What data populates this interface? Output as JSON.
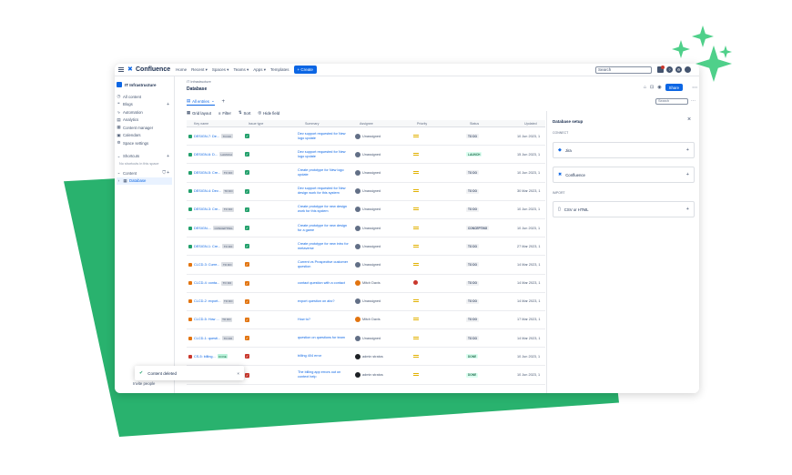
{
  "header": {
    "app_name": "Confluence",
    "nav": [
      "Home",
      "Recent ▾",
      "Spaces ▾",
      "Teams ▾",
      "Apps ▾",
      "Templates"
    ],
    "create_label": "+ Create",
    "search_placeholder": "Search"
  },
  "sidebar": {
    "space_name": "IT Infrastructure",
    "items": [
      {
        "icon": "clock-icon",
        "label": "All content"
      },
      {
        "icon": "blog-icon",
        "label": "Blogs"
      },
      {
        "icon": "bolt-icon",
        "label": "Automation"
      },
      {
        "icon": "chart-icon",
        "label": "Analytics"
      },
      {
        "icon": "content-icon",
        "label": "Content manager"
      },
      {
        "icon": "calendar-icon",
        "label": "Calendars"
      },
      {
        "icon": "gear-icon",
        "label": "Space settings"
      }
    ],
    "shortcuts_label": "Shortcuts",
    "shortcuts_note": "No shortcuts in this space",
    "content_label": "Content",
    "tree_item": "Database",
    "bottom_label": "Invite people"
  },
  "toast": {
    "message": "Content deleted"
  },
  "page": {
    "breadcrumb": "IT Infrastructure",
    "title": "Database",
    "share_label": "Share",
    "view_tab": "All entries",
    "search_placeholder": "Search",
    "toolbar": [
      "Grid layout",
      "Filter",
      "Sort",
      "Hide field"
    ]
  },
  "table": {
    "columns": [
      "Key name",
      "Issue type",
      "Summary",
      "Assignee",
      "Priority",
      "Status",
      "Updated"
    ],
    "rows": [
      {
        "key": "DESIGN-7: De...",
        "tag": "TO DO",
        "type": "green",
        "summary": "Dev support requested for New logo update",
        "assignee": "Unassigned",
        "avatar": "none",
        "priority": "medium",
        "status": "TO DO",
        "date": "10 Jun 2023, 1"
      },
      {
        "key": "DESIGN-6: D...",
        "tag": "LAUNCH",
        "type": "green",
        "summary": "Dev support requested for New logo update",
        "assignee": "Unassigned",
        "avatar": "none",
        "priority": "medium",
        "status": "LAUNCH",
        "date": "15 Jun 2023, 1"
      },
      {
        "key": "DESIGN-5: Cre...",
        "tag": "TO DO",
        "type": "green",
        "summary": "Create prototype for New logo update",
        "assignee": "Unassigned",
        "avatar": "none",
        "priority": "medium",
        "status": "TO DO",
        "date": "10 Jun 2023, 1"
      },
      {
        "key": "DESIGN-4: Dev...",
        "tag": "TO DO",
        "type": "green",
        "summary": "Dev support requested for New design work for this system",
        "assignee": "Unassigned",
        "avatar": "none",
        "priority": "medium",
        "status": "TO DO",
        "date": "30 Mar 2023, 1"
      },
      {
        "key": "DESIGN-3: Cre...",
        "tag": "TO DO",
        "type": "green",
        "summary": "Create prototype for new design work for this system",
        "assignee": "Unassigned",
        "avatar": "none",
        "priority": "medium",
        "status": "TO DO",
        "date": "10 Jun 2023, 1"
      },
      {
        "key": "DESIGN-...",
        "tag": "CONCEPTING",
        "type": "green",
        "summary": "Create prototype for new design for a game",
        "assignee": "Unassigned",
        "avatar": "none",
        "priority": "medium",
        "status": "CONCEPTING",
        "date": "10 Jun 2023, 1"
      },
      {
        "key": "DESIGN-1: Cre...",
        "tag": "TO DO",
        "type": "green",
        "summary": "Create prototype for new intro for metaverse",
        "assignee": "Unassigned",
        "avatar": "none",
        "priority": "medium",
        "status": "TO DO",
        "date": "27 Mar 2023, 1"
      },
      {
        "key": "CLCD-3: Curre...",
        "tag": "TO DO",
        "type": "orange",
        "summary": "Current vs Prospective customer question",
        "assignee": "Unassigned",
        "avatar": "none",
        "priority": "medium",
        "status": "TO DO",
        "date": "14 Mar 2023, 1"
      },
      {
        "key": "CLCD-4: conta...",
        "tag": "TO DO",
        "type": "orange",
        "summary": "contact question with a contact",
        "assignee": "Mitch Davis",
        "avatar": "mitch",
        "priority": "high",
        "status": "TO DO",
        "date": "14 Mar 2023, 1"
      },
      {
        "key": "CLCD-2: export...",
        "tag": "TO DO",
        "type": "orange",
        "summary": "export question on abc?",
        "assignee": "Unassigned",
        "avatar": "none",
        "priority": "medium",
        "status": "TO DO",
        "date": "14 Mar 2023, 1"
      },
      {
        "key": "CLCD-5: How ...",
        "tag": "TO DO",
        "type": "orange",
        "summary": "How to?",
        "assignee": "Mitch Davis",
        "avatar": "mitch",
        "priority": "medium",
        "status": "TO DO",
        "date": "17 Mar 2023, 1"
      },
      {
        "key": "CLCD-1: questi...",
        "tag": "TO DO",
        "type": "orange",
        "summary": "question on questions for team",
        "assignee": "Unassigned",
        "avatar": "none",
        "priority": "medium",
        "status": "TO DO",
        "date": "14 Mar 2023, 1"
      },
      {
        "key": "CS-5: billing...",
        "tag": "DONE",
        "type": "red",
        "summary": "billing 404 error",
        "assignee": "admin stratos",
        "avatar": "admin",
        "priority": "medium",
        "status": "DONE",
        "date": "10 Jun 2023, 1"
      },
      {
        "key": "CS-4: The billin...",
        "tag": "DONE",
        "type": "red",
        "summary": "The billing app errors out on context help",
        "assignee": "admin stratos",
        "avatar": "admin",
        "priority": "medium",
        "status": "DONE",
        "date": "10 Jun 2023, 1"
      }
    ]
  },
  "panel": {
    "title": "Database setup",
    "connect_label": "CONNECT",
    "cards": [
      {
        "icon": "jira-icon",
        "label": "Jira"
      },
      {
        "icon": "confluence-icon",
        "label": "Confluence"
      }
    ],
    "import_label": "IMPORT",
    "import_card": {
      "icon": "file-icon",
      "label": "CSV or HTML"
    }
  }
}
